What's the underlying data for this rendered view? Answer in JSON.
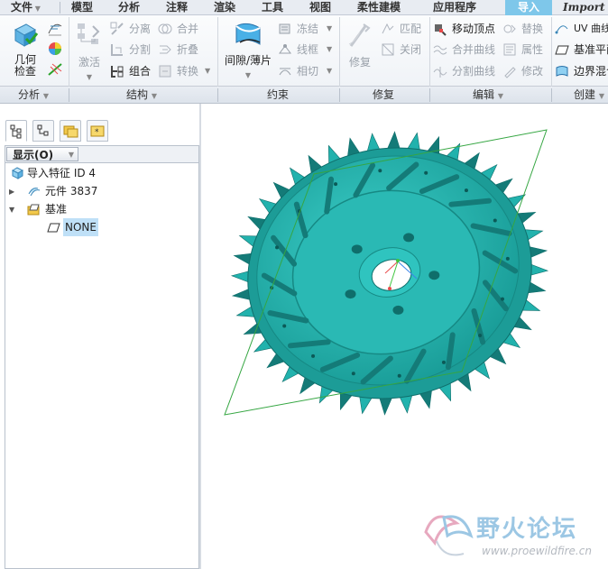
{
  "menu_tabs": [
    {
      "label": "文件"
    },
    {
      "label": "模型"
    },
    {
      "label": "分析"
    },
    {
      "label": "注释"
    },
    {
      "label": "渲染"
    },
    {
      "label": "工具"
    },
    {
      "label": "视图"
    },
    {
      "label": "柔性建模"
    },
    {
      "label": "应用程序"
    },
    {
      "label": "导入"
    },
    {
      "label": "Import"
    }
  ],
  "ribbon": {
    "analysis": {
      "geometry_check": "几何\n检查",
      "group_label": "分析"
    },
    "structure": {
      "activate": "激活",
      "detach": "分离",
      "split": "分割",
      "combine": "组合",
      "merge": "合并",
      "fold": "折叠",
      "convert": "转换",
      "group_label": "结构"
    },
    "constraint": {
      "gap_thin": "间隙/薄片",
      "freeze": "冻结",
      "wireframe": "线框",
      "tangent": "相切",
      "group_label": "约束"
    },
    "repair": {
      "repair": "修复",
      "match": "匹配",
      "close": "关闭",
      "group_label": "修复"
    },
    "edit": {
      "move_vertex": "移动顶点",
      "merge_curves": "合并曲线",
      "split_curves": "分割曲线",
      "replace": "替换",
      "properties": "属性",
      "modify": "修改",
      "group_label": "编辑"
    },
    "create": {
      "uv_curve": "UV 曲线",
      "datum_plane": "基准平面",
      "boundary_blend": "边界混合",
      "group_label": "创建"
    }
  },
  "left_panel": {
    "show_button": "显示(O)",
    "tree": [
      {
        "label": "导入特征 ID 4",
        "expander": ""
      },
      {
        "label": "元件 3837",
        "expander": "▶"
      },
      {
        "label": "基准",
        "expander": "▼"
      },
      {
        "label": "NONE",
        "expander": ""
      }
    ]
  },
  "colors": {
    "part_teal": "#22b2ad",
    "part_shadow": "#147b78",
    "datum_plane_edge": "#35a642",
    "active_tab": "#7ec7ea",
    "selected_row": "#bfe0f7"
  },
  "watermark": {
    "title": "野火论坛",
    "url": "www.proewildfire.cn"
  }
}
